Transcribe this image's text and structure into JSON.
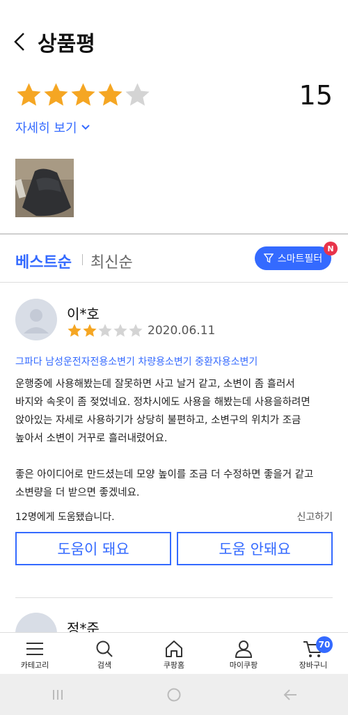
{
  "header": {
    "title": "상품평"
  },
  "summary": {
    "rating": 4,
    "max_rating": 5,
    "count": "15",
    "detail_label": "자세히 보기"
  },
  "sort": {
    "best_label": "베스트순",
    "new_label": "최신순",
    "smart_filter_label": "스마트필터",
    "filter_badge": "N"
  },
  "review": {
    "reviewer": "이*호",
    "rating": 2,
    "date": "2020.06.11",
    "product_name": "그파다 남성운전자전용소변기 차량용소변기 중환자용소변기",
    "text": "운행중에 사용해봤는데 잘못하면 사고 날거 같고, 소변이 좀 흘러서\n바지와 속옷이 좀 젖었네요. 정차시에도 사용을 해봤는데 사용을하려면\n앉아있는 자세로 사용하기가 상당히 불편하고, 소변구의 위치가 조금\n높아서 소변이 거꾸로 흘러내렸어요.\n\n좋은 아이디어로 만드셨는데 모양 높이를 조금 더 수정하면 좋을거 같고\n소변량을 더 받으면 좋겠네요.",
    "helpful_count": "12명에게 도움됐습니다.",
    "report_label": "신고하기",
    "helpful_yes": "도움이 돼요",
    "helpful_no": "도움 안돼요"
  },
  "next_review": {
    "reviewer": "정*준"
  },
  "bottom_nav": {
    "items": [
      {
        "label": "카테고리",
        "icon": "menu-icon"
      },
      {
        "label": "검색",
        "icon": "search-icon"
      },
      {
        "label": "쿠팡홈",
        "icon": "home-icon"
      },
      {
        "label": "마이쿠팡",
        "icon": "user-icon"
      },
      {
        "label": "장바구니",
        "icon": "cart-icon"
      }
    ],
    "cart_badge": "70"
  },
  "colors": {
    "accent": "#346aff",
    "star": "#f5a623",
    "star_empty": "#d4d4d4",
    "badge_red": "#e8334a"
  }
}
